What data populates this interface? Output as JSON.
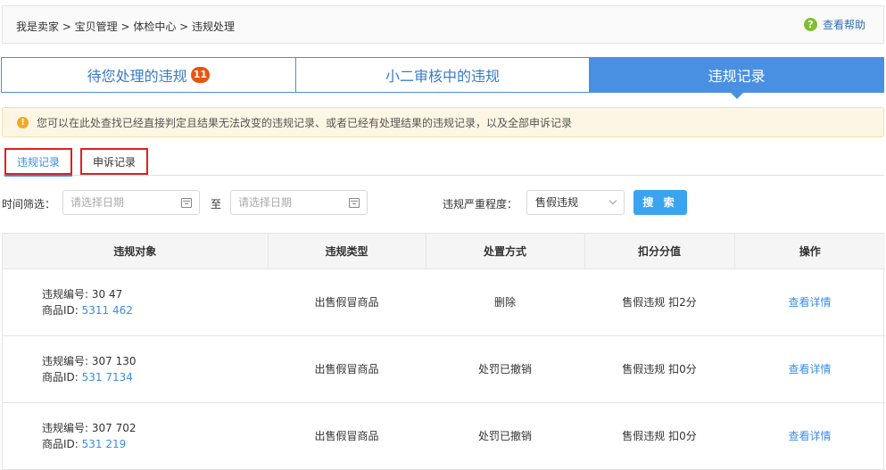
{
  "breadcrumb": {
    "text": "我是卖家 > 宝贝管理 > 体检中心 > 违规处理"
  },
  "help": {
    "icon": "question-icon",
    "label": "查看帮助"
  },
  "tabs": [
    {
      "label": "待您处理的违规",
      "badge": "11",
      "active": false
    },
    {
      "label": "小二审核中的违规",
      "active": false
    },
    {
      "label": "违规记录",
      "active": true
    }
  ],
  "notice": {
    "icon": "warning-icon",
    "text": "您可以在此处查找已经直接判定且结果无法改变的违规记录、或者已经有处理结果的违规记录，以及全部申诉记录"
  },
  "subtabs": [
    {
      "label": "违规记录",
      "active": true
    },
    {
      "label": "申诉记录",
      "active": false
    }
  ],
  "filter": {
    "time_label": "时间筛选：",
    "start_placeholder": "请选择日期",
    "to_label": "至",
    "end_placeholder": "请选择日期",
    "severity_label": "违规严重程度：",
    "severity_value": "售假违规",
    "search_label": "搜 索"
  },
  "table": {
    "headers": [
      "违规对象",
      "违规类型",
      "处置方式",
      "扣分分值",
      "操作"
    ],
    "rows": [
      {
        "violation_no_label": "违规编号: ",
        "violation_no": "30        47",
        "item_id_label": "商品ID: ",
        "item_id": "5311        462",
        "type": "出售假冒商品",
        "action": "删除",
        "score": "售假违规 扣2分",
        "op": "查看详情"
      },
      {
        "violation_no_label": "违规编号: ",
        "violation_no": "307      130",
        "item_id_label": "商品ID: ",
        "item_id": "531        7134",
        "type": "出售假冒商品",
        "action": "处罚已撤销",
        "score": "售假违规 扣0分",
        "op": "查看详情"
      },
      {
        "violation_no_label": "违规编号: ",
        "violation_no": "307      702",
        "item_id_label": "商品ID: ",
        "item_id": "531        219",
        "type": "出售假冒商品",
        "action": "处罚已撤销",
        "score": "售假违规 扣0分",
        "op": "查看详情"
      }
    ]
  },
  "colors": {
    "tab_active_bg": "#4a90e2",
    "tab_text": "#3a7bc8",
    "badge": "#e8540f",
    "link": "#3a8ee6",
    "search_button": "#3aa4f0",
    "highlight_border": "#e02020",
    "notice_bg": "#fef6e4"
  }
}
